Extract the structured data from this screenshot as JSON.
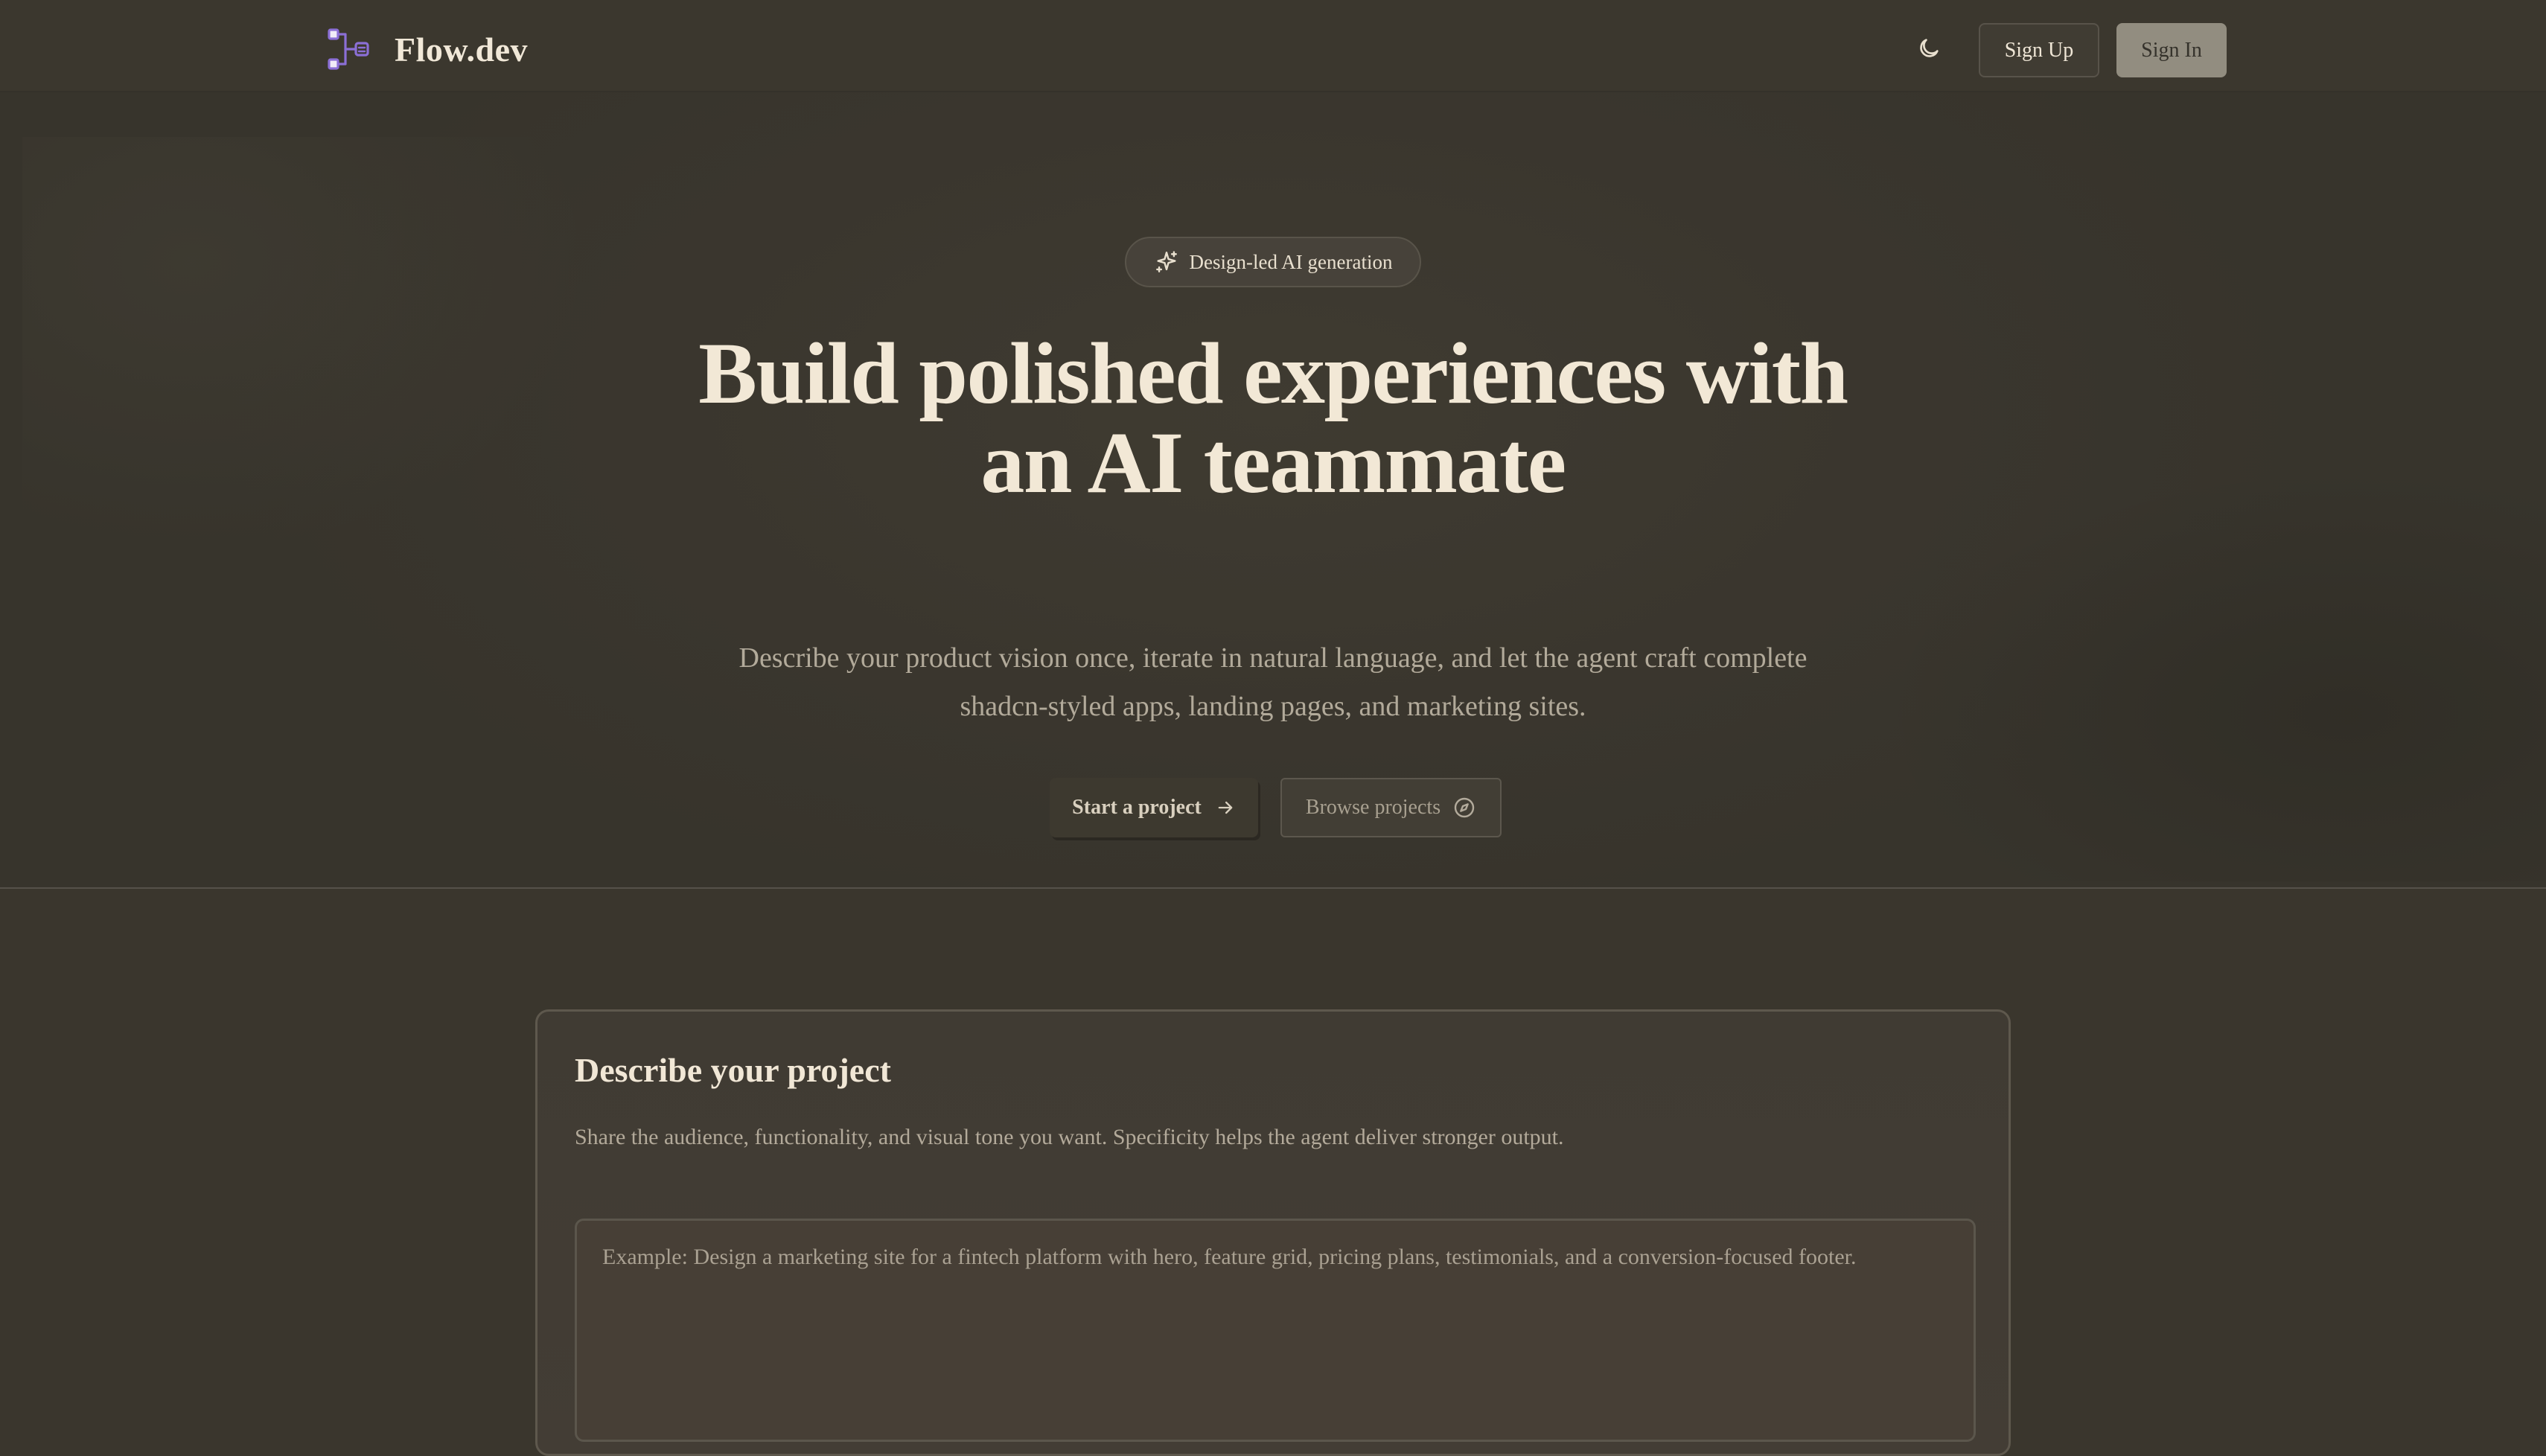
{
  "header": {
    "brand_name": "Flow.dev",
    "brand_icon": "flow-diagram-icon",
    "theme_toggle_icon": "moon-icon",
    "sign_up_label": "Sign Up",
    "sign_in_label": "Sign In"
  },
  "hero": {
    "badge_icon": "sparkles-icon",
    "badge_label": "Design-led AI generation",
    "title_line1": "Build polished experiences with",
    "title_line2": "an AI teammate",
    "subtitle_line1": "Describe your product vision once, iterate in natural language, and let the agent craft complete",
    "subtitle_line2": "shadcn-styled apps, landing pages, and marketing sites.",
    "start_label": "Start a project",
    "start_icon": "arrow-right-icon",
    "browse_label": "Browse projects",
    "browse_icon": "compass-icon"
  },
  "describe": {
    "title": "Describe your project",
    "description": "Share the audience, functionality, and visual tone you want. Specificity helps the agent deliver stronger output.",
    "input_placeholder": "Example: Design a marketing site for a fintech platform with hero, feature grid, pricing plans, testimonials, and a conversion-focused footer.",
    "input_value": ""
  },
  "colors": {
    "background": "#3a362d",
    "accent_logo": "#8b6fd6",
    "text_primary": "#f2e8d6",
    "text_muted": "#b2aa9a",
    "sign_in_bg": "#928d80"
  }
}
